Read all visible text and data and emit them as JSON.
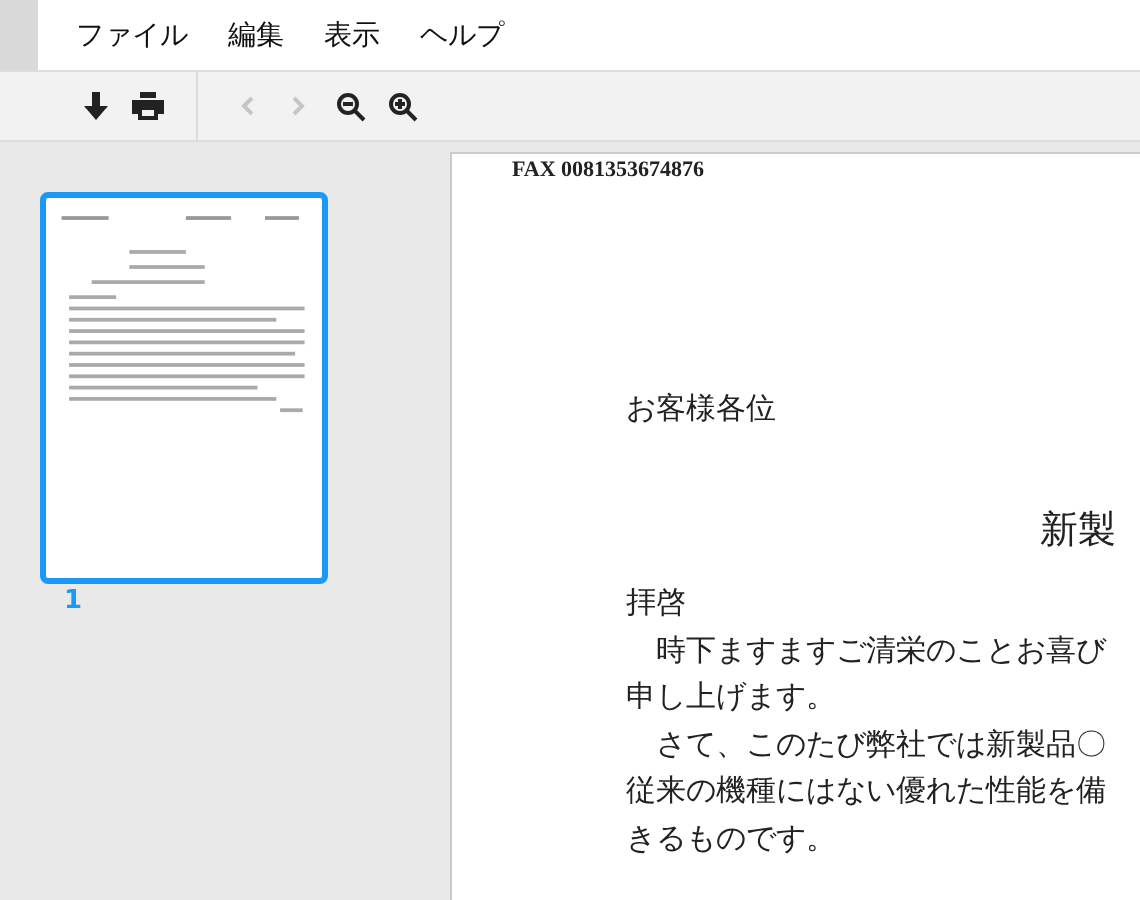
{
  "menu": [
    {
      "label": "ファイル"
    },
    {
      "label": "編集"
    },
    {
      "label": "表示"
    },
    {
      "label": "ヘルプ"
    }
  ],
  "toolbar": [
    {
      "kind": "download",
      "disabled": false
    },
    {
      "kind": "print",
      "disabled": false
    },
    {
      "kind": "separator"
    },
    {
      "kind": "prev",
      "disabled": true
    },
    {
      "kind": "next",
      "disabled": true
    },
    {
      "kind": "zoom_out",
      "disabled": false
    },
    {
      "kind": "zoom_in",
      "disabled": false
    }
  ],
  "thumbnails": [
    {
      "label": "1",
      "selected": true
    }
  ],
  "document": {
    "fax_line": "FAX 0081353674876",
    "addressee": "お客様各位",
    "title": "新製",
    "lines": [
      "拝啓",
      "　時下ますますご清栄のことお喜び",
      "申し上げます。",
      "　さて、このたび弊社では新製品〇",
      "従来の機種にはない優れた性能を備",
      "きるものです。"
    ]
  }
}
